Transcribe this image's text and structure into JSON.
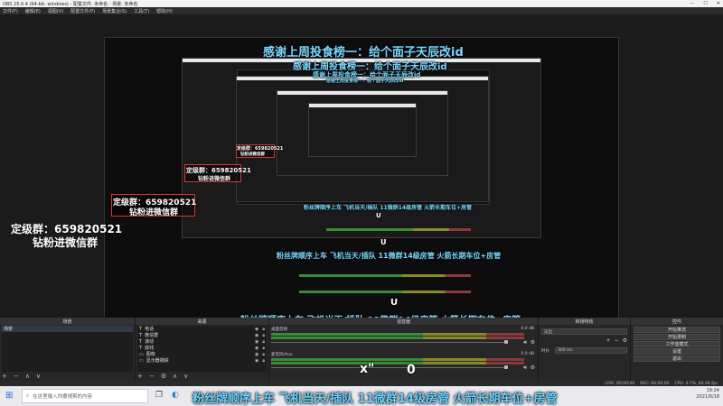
{
  "window": {
    "title": "OBS 25.0.4 (64-bit, windows) - 配置文件: 未命名 - 场景: 未命名"
  },
  "menu": [
    "文件(F)",
    "编辑(E)",
    "视图(V)",
    "配置文件(P)",
    "场景集合(S)",
    "工具(T)",
    "帮助(H)"
  ],
  "overlays": {
    "title_thanks": "感谢上周投食榜一：给个面子天辰改id",
    "group_number": "定级群：659820521",
    "group_note": "钻粉进微信群",
    "banner": "粉丝牌顺序上车 飞机当天/插队 11微群14级房管 火箭长期车位+房管",
    "xo_left": "x\"",
    "xo_right": "0",
    "nested_mark": "U"
  },
  "docks": {
    "scenes": {
      "title": "场景",
      "items": [
        "场景"
      ],
      "footer": [
        "+",
        "−",
        "∧",
        "∨"
      ]
    },
    "sources": {
      "title": "来源",
      "items": [
        {
          "icon": "T",
          "label": "电话"
        },
        {
          "icon": "T",
          "label": "微信群"
        },
        {
          "icon": "T",
          "label": "滚动"
        },
        {
          "icon": "T",
          "label": "底线"
        },
        {
          "icon": "▭",
          "label": "图像"
        },
        {
          "icon": "▭",
          "label": "显示器捕获"
        }
      ],
      "footer": [
        "+",
        "−",
        "⚙",
        "∧",
        "∨"
      ]
    },
    "mixer": {
      "title": "混音器",
      "channels": [
        {
          "name": "桌面音频",
          "level": "0.0 dB"
        },
        {
          "name": "麦克风/Aux",
          "level": "0.0 dB"
        }
      ]
    },
    "transitions": {
      "title": "转场特效",
      "type": "淡出",
      "duration_label": "时长",
      "duration_value": "300 ms",
      "footer": [
        "+",
        "−",
        "⚙"
      ]
    },
    "controls": {
      "title": "控件",
      "buttons": [
        "开始推流",
        "开始录制",
        "工作室模式",
        "设置",
        "退出"
      ]
    }
  },
  "statusbar": {
    "live": "LIVE: 00:00:00",
    "rec": "REC: 00:00:00",
    "cpu": "CPU: 0.7%, 60.00 fps"
  },
  "taskbar": {
    "search_placeholder": "在这里输入你要搜索的内容",
    "time": "19:24",
    "date": "2021/6/18"
  },
  "colors": {
    "accent_text": "#7ad7ff",
    "group_border": "#dd3333"
  }
}
